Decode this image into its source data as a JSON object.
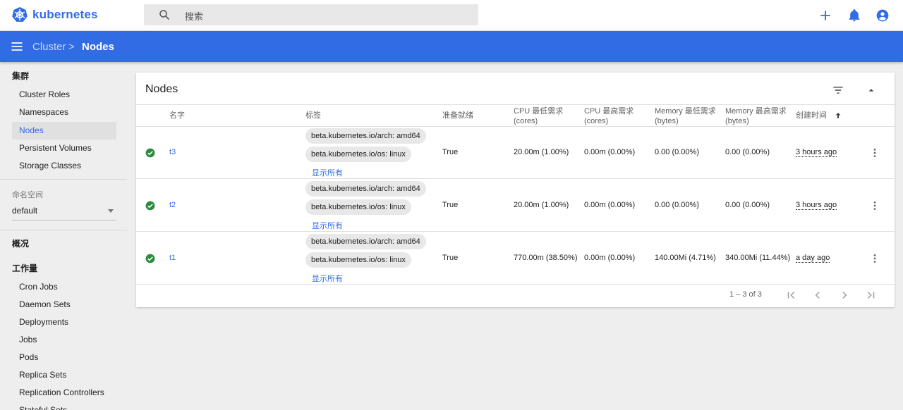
{
  "topbar": {
    "brand": "kubernetes",
    "search_placeholder": "搜索"
  },
  "toolbar": {
    "breadcrumb_parent": "Cluster",
    "breadcrumb_separator": ">",
    "breadcrumb_current": "Nodes"
  },
  "sidebar": {
    "cluster_section": "集群",
    "cluster_items": [
      "Cluster Roles",
      "Namespaces",
      "Nodes",
      "Persistent Volumes",
      "Storage Classes"
    ],
    "namespace_label": "命名空间",
    "namespace_value": "default",
    "overview": "概况",
    "workloads_section": "工作量",
    "workload_items": [
      "Cron Jobs",
      "Daemon Sets",
      "Deployments",
      "Jobs",
      "Pods",
      "Replica Sets",
      "Replication Controllers",
      "Stateful Sets"
    ]
  },
  "card": {
    "title": "Nodes",
    "headers": {
      "name": "名字",
      "labels": "标签",
      "ready": "准备就绪",
      "cpu_requests": "CPU 最低需求",
      "cpu_requests_unit": "(cores)",
      "cpu_limits": "CPU 最高需求",
      "cpu_limits_unit": "(cores)",
      "mem_requests": "Memory 最低需求",
      "mem_requests_unit": "(bytes)",
      "mem_limits": "Memory 最高需求",
      "mem_limits_unit": "(bytes)",
      "created": "创建时间"
    },
    "rows": [
      {
        "name": "t3",
        "label_arch": "beta.kubernetes.io/arch: amd64",
        "label_os": "beta.kubernetes.io/os: linux",
        "show_all": "显示所有",
        "ready": "True",
        "cpu_requests": "20.00m (1.00%)",
        "cpu_limits": "0.00m (0.00%)",
        "mem_requests": "0.00 (0.00%)",
        "mem_limits": "0.00 (0.00%)",
        "created": "3 hours ago"
      },
      {
        "name": "t2",
        "label_arch": "beta.kubernetes.io/arch: amd64",
        "label_os": "beta.kubernetes.io/os: linux",
        "show_all": "显示所有",
        "ready": "True",
        "cpu_requests": "20.00m (1.00%)",
        "cpu_limits": "0.00m (0.00%)",
        "mem_requests": "0.00 (0.00%)",
        "mem_limits": "0.00 (0.00%)",
        "created": "3 hours ago"
      },
      {
        "name": "t1",
        "label_arch": "beta.kubernetes.io/arch: amd64",
        "label_os": "beta.kubernetes.io/os: linux",
        "show_all": "显示所有",
        "ready": "True",
        "cpu_requests": "770.00m (38.50%)",
        "cpu_limits": "0.00m (0.00%)",
        "mem_requests": "140.00Mi (4.71%)",
        "mem_limits": "340.00Mi (11.44%)",
        "created": "a day ago"
      }
    ],
    "pagination": "1 – 3 of 3"
  },
  "colors": {
    "brand_blue": "#326ce5",
    "ready_green": "#2e8b3e"
  }
}
